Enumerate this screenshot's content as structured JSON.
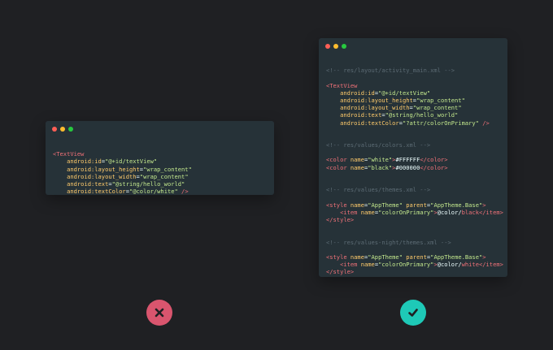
{
  "colors": {
    "background": "#1f2023",
    "window_bg": "#263238",
    "dot_red": "#ff5f56",
    "dot_yellow": "#ffbd2e",
    "dot_green": "#27c93f",
    "tag": "#f07178",
    "attr_name": "#ffcb6b",
    "string": "#c3e88d",
    "comment": "#5c6b74",
    "bad": "#d9556e",
    "good": "#1ec9b7"
  },
  "left_window": {
    "lines": [
      {
        "tag_open": "<TextView"
      },
      {
        "attr": "android:id",
        "eq": "=",
        "val": "\"@+id/textView\""
      },
      {
        "attr": "android:layout_height",
        "eq": "=",
        "val": "\"wrap_content\""
      },
      {
        "attr": "android:layout_width",
        "eq": "=",
        "val": "\"wrap_content\""
      },
      {
        "attr": "android:text",
        "eq": "=",
        "val": "\"@string/hello_world\""
      },
      {
        "attr": "android:textColor",
        "eq": "=",
        "val": "\"@color/white\"",
        "close": " />"
      }
    ]
  },
  "right_window": {
    "comment1": "<!-- res/layout/activity_main.xml -->",
    "textview": {
      "open": "<TextView",
      "id_attr": "android:id",
      "id_val": "\"@+id/textView\"",
      "h_attr": "android:layout_height",
      "h_val": "\"wrap_content\"",
      "w_attr": "android:layout_width",
      "w_val": "\"wrap_content\"",
      "t_attr": "android:text",
      "t_val": "\"@string/hello_world\"",
      "c_attr": "android:textColor",
      "c_val": "\"?attr/colorOnPrimary\"",
      "close": " />"
    },
    "comment2": "<!-- res/values/colors.xml -->",
    "color1": {
      "open": "<color",
      "attr": " name",
      "val": "\"white\"",
      "gt": ">",
      "text": "#FFFFFF",
      "end": "</color>"
    },
    "color2": {
      "open": "<color",
      "attr": " name",
      "val": "\"black\"",
      "gt": ">",
      "text": "#000000",
      "end": "</color>"
    },
    "comment3": "<!-- res/values/themes.xml -->",
    "style1": {
      "open": "<style",
      "name_attr": " name",
      "name_val": "\"AppTheme\"",
      "parent_attr": " parent",
      "parent_val": "\"AppTheme.Base\"",
      "gt": ">",
      "item_open": "<item",
      "item_attr": " name",
      "item_val": "\"colorOnPrimary\"",
      "item_gt": ">",
      "item_pre": "@color/",
      "item_text": "black",
      "item_end": "</item>",
      "end": "</style>"
    },
    "comment4": "<!-- res/values-night/themes.xml -->",
    "style2": {
      "open": "<style",
      "name_attr": " name",
      "name_val": "\"AppTheme\"",
      "parent_attr": " parent",
      "parent_val": "\"AppTheme.Base\"",
      "gt": ">",
      "item_open": "<item",
      "item_attr": " name",
      "item_val": "\"colorOnPrimary\"",
      "item_gt": ">",
      "item_pre": "@color/",
      "item_text": "white",
      "item_end": "</item>",
      "end": "</style>"
    }
  },
  "badges": {
    "bad_icon": "cross-icon",
    "good_icon": "check-icon"
  }
}
